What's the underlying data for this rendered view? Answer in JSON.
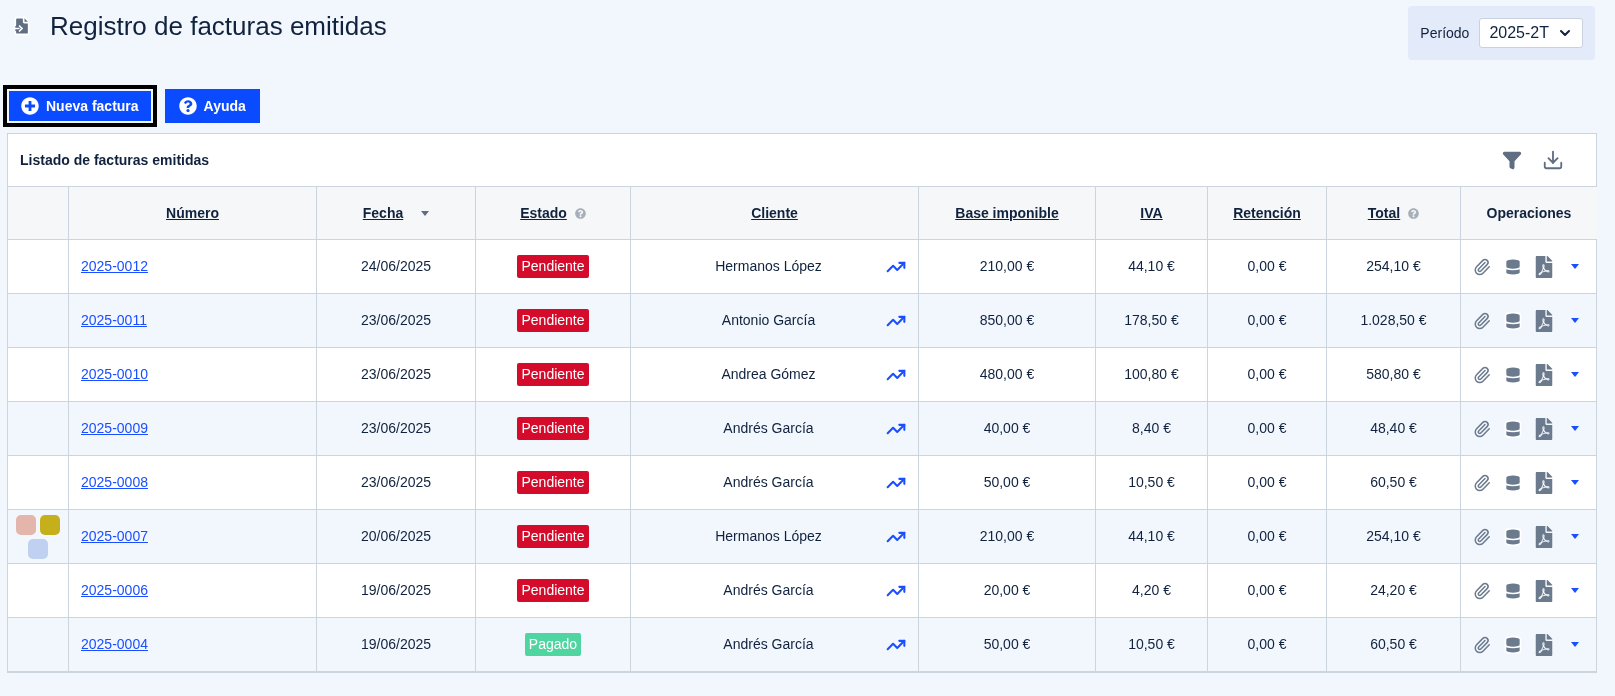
{
  "page": {
    "title": "Registro de facturas emitidas"
  },
  "period": {
    "label": "Período",
    "value": "2025-2T"
  },
  "actions": [
    {
      "label": "Nueva factura",
      "kind": "new",
      "focused": true
    },
    {
      "label": "Ayuda",
      "kind": "help",
      "focused": false
    }
  ],
  "table": {
    "title": "Listado de facturas emitidas",
    "columns": [
      {
        "label": "Número",
        "sortable": true,
        "help": false,
        "sorted": false
      },
      {
        "label": "Fecha",
        "sortable": true,
        "help": false,
        "sorted": true
      },
      {
        "label": "Estado",
        "sortable": true,
        "help": true,
        "sorted": false
      },
      {
        "label": "Cliente",
        "sortable": true,
        "help": false,
        "sorted": false
      },
      {
        "label": "Base imponible",
        "sortable": true,
        "help": false,
        "sorted": false
      },
      {
        "label": "IVA",
        "sortable": true,
        "help": false,
        "sorted": false
      },
      {
        "label": "Retención",
        "sortable": true,
        "help": false,
        "sorted": false
      },
      {
        "label": "Total",
        "sortable": true,
        "help": true,
        "sorted": false
      },
      {
        "label": "Operaciones",
        "sortable": false,
        "help": false,
        "sorted": false
      }
    ],
    "rows": [
      {
        "tags": [],
        "number": "2025-0012",
        "date": "24/06/2025",
        "status": {
          "label": "Pendiente",
          "kind": "pending"
        },
        "client": "Hermanos López",
        "base": "210,00 €",
        "iva": "44,10 €",
        "retention": "0,00 €",
        "total": "254,10 €"
      },
      {
        "tags": [],
        "number": "2025-0011",
        "date": "23/06/2025",
        "status": {
          "label": "Pendiente",
          "kind": "pending"
        },
        "client": "Antonio García",
        "base": "850,00 €",
        "iva": "178,50 €",
        "retention": "0,00 €",
        "total": "1.028,50 €"
      },
      {
        "tags": [],
        "number": "2025-0010",
        "date": "23/06/2025",
        "status": {
          "label": "Pendiente",
          "kind": "pending"
        },
        "client": "Andrea Gómez",
        "base": "480,00 €",
        "iva": "100,80 €",
        "retention": "0,00 €",
        "total": "580,80 €"
      },
      {
        "tags": [],
        "number": "2025-0009",
        "date": "23/06/2025",
        "status": {
          "label": "Pendiente",
          "kind": "pending"
        },
        "client": "Andrés García",
        "base": "40,00 €",
        "iva": "8,40 €",
        "retention": "0,00 €",
        "total": "48,40 €"
      },
      {
        "tags": [],
        "number": "2025-0008",
        "date": "23/06/2025",
        "status": {
          "label": "Pendiente",
          "kind": "pending"
        },
        "client": "Andrés García",
        "base": "50,00 €",
        "iva": "10,50 €",
        "retention": "0,00 €",
        "total": "60,50 €"
      },
      {
        "tags": [
          {
            "color": "#e3b5ab"
          },
          {
            "color": "#c5b01b"
          },
          {
            "color": "#bfd0f0"
          }
        ],
        "number": "2025-0007",
        "date": "20/06/2025",
        "status": {
          "label": "Pendiente",
          "kind": "pending"
        },
        "client": "Hermanos López",
        "base": "210,00 €",
        "iva": "44,10 €",
        "retention": "0,00 €",
        "total": "254,10 €"
      },
      {
        "tags": [],
        "number": "2025-0006",
        "date": "19/06/2025",
        "status": {
          "label": "Pendiente",
          "kind": "pending"
        },
        "client": "Andrés García",
        "base": "20,00 €",
        "iva": "4,20 €",
        "retention": "0,00 €",
        "total": "24,20 €"
      },
      {
        "tags": [],
        "number": "2025-0004",
        "date": "19/06/2025",
        "status": {
          "label": "Pagado",
          "kind": "paid"
        },
        "client": "Andrés García",
        "base": "50,00 €",
        "iva": "10,50 €",
        "retention": "0,00 €",
        "total": "60,50 €"
      }
    ]
  }
}
